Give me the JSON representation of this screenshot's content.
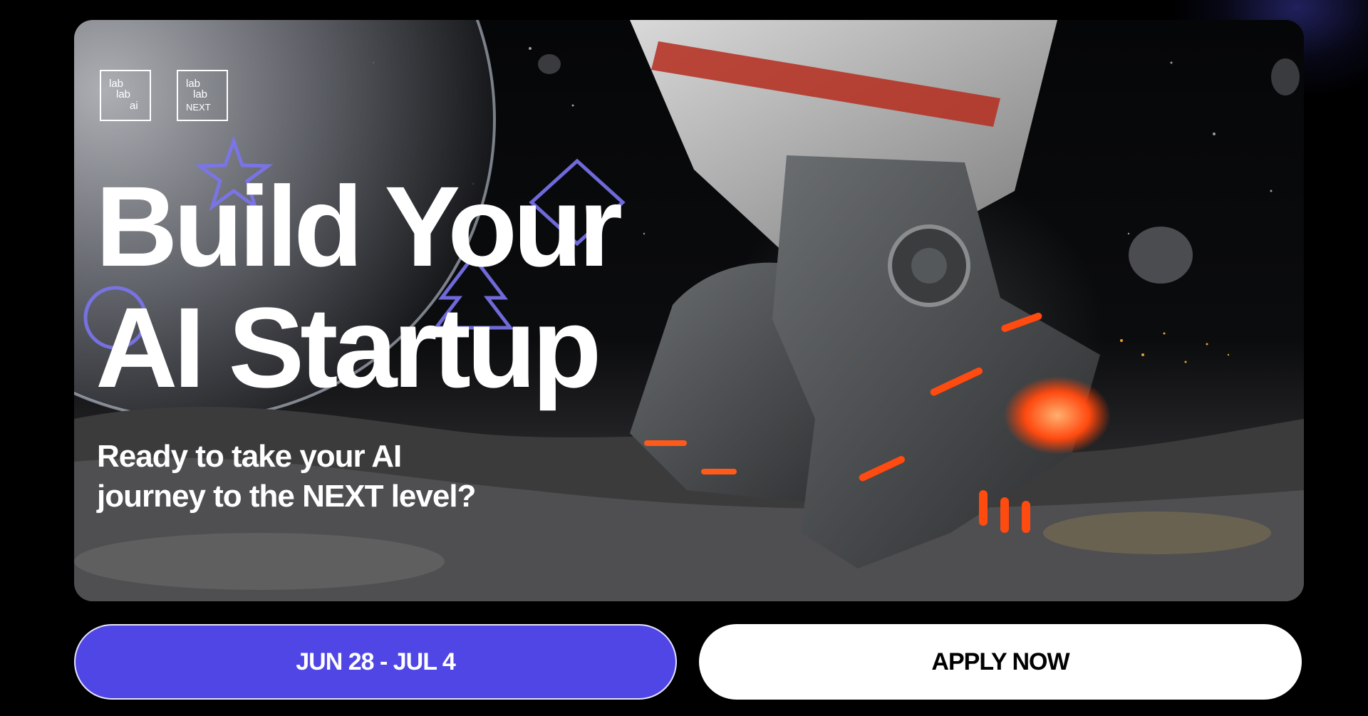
{
  "page": {
    "background": "#000000",
    "accent": "#4f46e5"
  },
  "hero": {
    "logos": [
      {
        "lines": [
          "lab",
          "lab",
          "ai"
        ]
      },
      {
        "lines": [
          "lab",
          "lab",
          "NEXT"
        ]
      }
    ],
    "headline": [
      "Build Your",
      "AI Startup"
    ],
    "subline": [
      "Ready to take your AI",
      "journey to the NEXT level?"
    ],
    "icons": [
      "star-icon",
      "diamond-icon",
      "tree-icon",
      "circle-icon"
    ]
  },
  "actions": {
    "date_label": "JUN 28 - JUL 4",
    "apply_label": "APPLY NOW",
    "date_color": "#4f46e5",
    "apply_color": "#ffffff"
  }
}
